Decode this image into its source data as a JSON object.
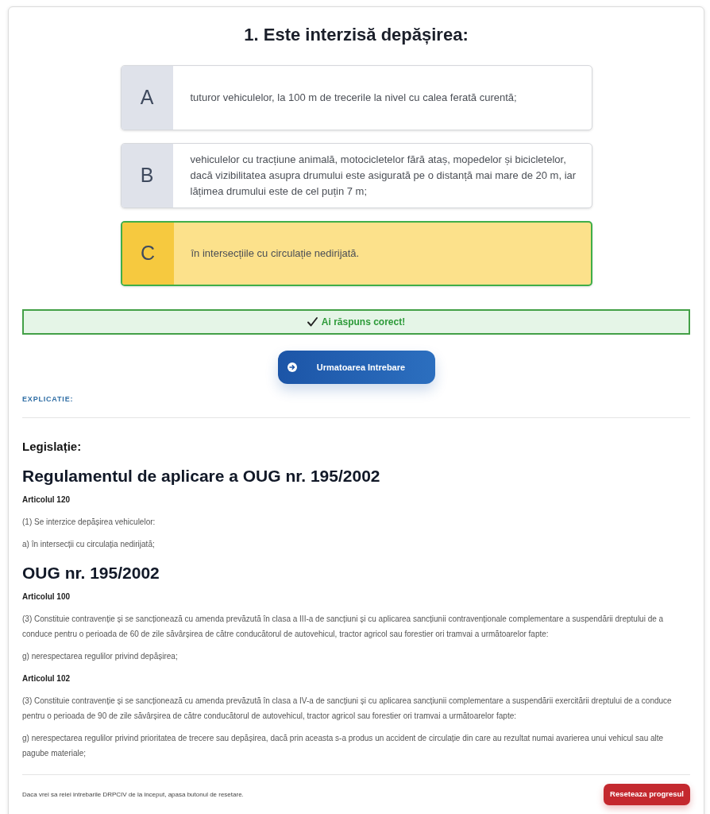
{
  "question": {
    "title": "1. Este interzisă depășirea:"
  },
  "answers": [
    {
      "letter": "A",
      "text": "tuturor vehiculelor, la 100 m de trecerile la nivel cu calea ferată curentă;",
      "selected": false,
      "correct": false
    },
    {
      "letter": "B",
      "text": "vehiculelor cu tracțiune animală, motocicletelor fără ataș, mopedelor și bicicletelor, dacă vizibilitatea asupra drumului este asigurată pe o distanță mai mare de 20 m, iar lățimea drumului este de cel puțin 7 m;",
      "selected": false,
      "correct": false
    },
    {
      "letter": "C",
      "text": "în intersecțiile cu circulație nedirijată.",
      "selected": true,
      "correct": true
    }
  ],
  "result": {
    "kind": "correct",
    "text": "Ai răspuns corect!"
  },
  "next_button": {
    "label": "Urmatoarea Intrebare"
  },
  "explanation": {
    "label": "EXPLICATIE:",
    "heading": "Legislație:",
    "sections": [
      {
        "title": "Regulamentul de aplicare a OUG nr. 195/2002",
        "blocks": [
          {
            "kind": "article",
            "text": "Articolul 120"
          },
          {
            "kind": "paragraph",
            "text": "(1) Se interzice depășirea vehiculelor:"
          },
          {
            "kind": "paragraph",
            "text": "a) în intersecții cu circulația nedirijată;"
          }
        ]
      },
      {
        "title": "OUG nr. 195/2002",
        "blocks": [
          {
            "kind": "article",
            "text": "Articolul 100"
          },
          {
            "kind": "paragraph",
            "text": "(3) Constituie contravenție și se sancționează cu amenda prevăzută în clasa a III-a de sancțiuni și cu aplicarea sancțiunii contravenționale complementare a suspendării dreptului de a conduce pentru o perioada de 60 de zile săvârșirea de către conducătorul de autovehicul, tractor agricol sau forestier ori tramvai a următoarelor fapte:"
          },
          {
            "kind": "paragraph",
            "text": "g) nerespectarea regulilor privind depășirea;"
          },
          {
            "kind": "article",
            "text": "Articolul 102"
          },
          {
            "kind": "paragraph",
            "text": "(3) Constituie contravenție și se sancționează cu amenda prevăzută în clasa a IV-a de sancțiuni și cu aplicarea sancțiunii complementare a suspendării exercitării dreptului de a conduce pentru o perioada de 90 de zile săvârșirea de către conducătorul de autovehicul, tractor agricol sau forestier ori tramvai a următoarelor fapte:"
          },
          {
            "kind": "paragraph",
            "text": "g) nerespectarea regulilor privind prioritatea de trecere sau depășirea, dacă prin aceasta s-a produs un accident de circulație din care au rezultat numai avarierea unui vehicul sau alte pagube materiale;"
          }
        ]
      }
    ]
  },
  "footer": {
    "text": "Daca vrei sa reiei intrebarile DRPCIV de la inceput, apasa butonul de resetare.",
    "reset_button": "Reseteaza progresul"
  }
}
